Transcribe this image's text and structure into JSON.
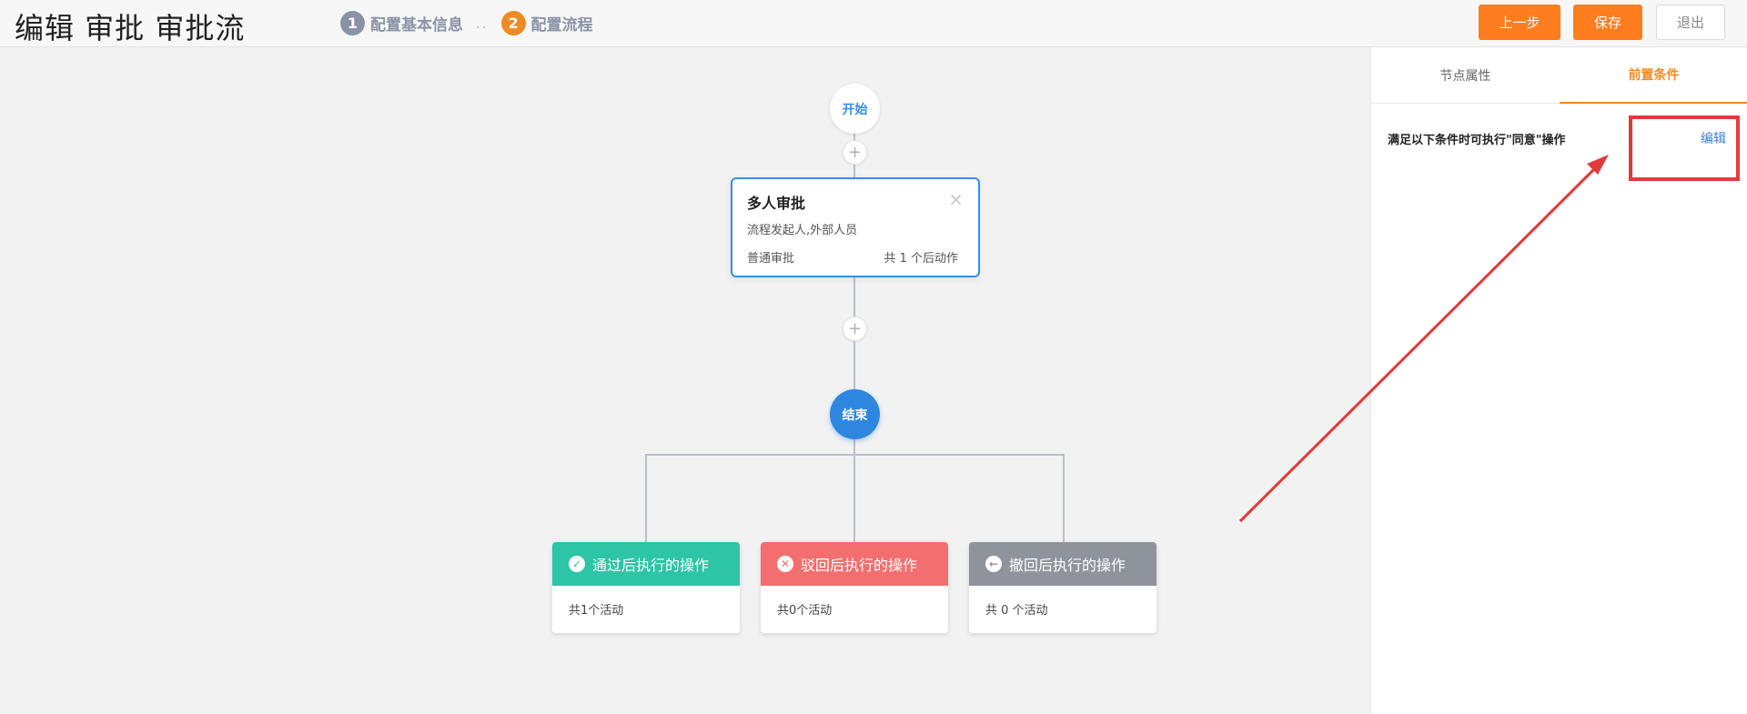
{
  "header": {
    "title": "编辑 审批 审批流",
    "steps": [
      {
        "num": "1",
        "label": "配置基本信息"
      },
      {
        "num": "2",
        "label": "配置流程"
      }
    ],
    "step_separator": "..",
    "buttons": {
      "prev": "上一步",
      "save": "保存",
      "exit": "退出"
    }
  },
  "flow": {
    "start_label": "开始",
    "end_label": "结束",
    "add_symbol": "+",
    "approve_node": {
      "title": "多人审批",
      "close_symbol": "×",
      "subtitle": "流程发起人,外部人员",
      "type": "普通审批",
      "count": "共 1 个后动作"
    },
    "actions": [
      {
        "icon_glyph": "✓",
        "icon": "check-circle-icon",
        "title": "通过后执行的操作",
        "body": "共1个活动"
      },
      {
        "icon_glyph": "✕",
        "icon": "close-circle-icon",
        "title": "驳回后执行的操作",
        "body": "共0个活动"
      },
      {
        "icon_glyph": "←",
        "icon": "arrow-left-circle-icon",
        "title": "撤回后执行的操作",
        "body": "共 0 个活动"
      }
    ]
  },
  "side_panel": {
    "tabs": [
      {
        "label": "节点属性",
        "active": false
      },
      {
        "label": "前置条件",
        "active": true
      }
    ],
    "condition_label": "满足以下条件时可执行\"同意\"操作",
    "edit_link": "编辑"
  },
  "colors": {
    "accent_orange": "#ff7d1f",
    "step_inactive": "#8a93a6",
    "step_active": "#f08a24",
    "primary_blue": "#2f86de",
    "link_blue": "#3a7fd0",
    "pass_green": "#2ec4a6",
    "reject_red": "#f36f6f",
    "withdraw_gray": "#8f949c",
    "annotation_red": "#e23a3a"
  }
}
